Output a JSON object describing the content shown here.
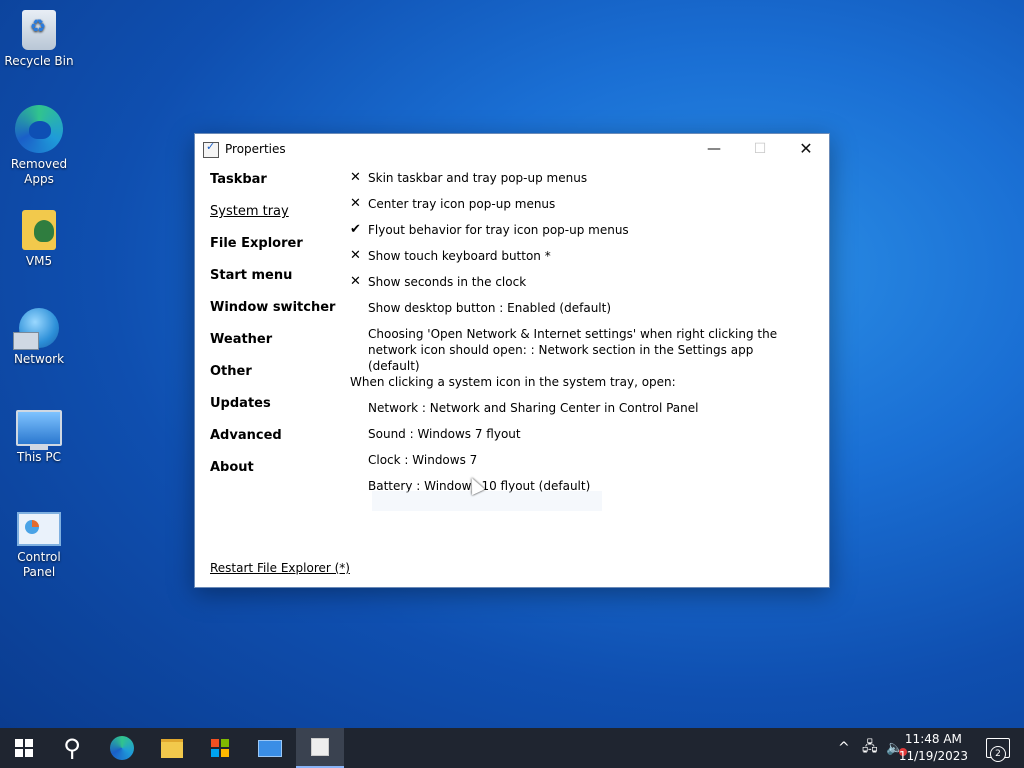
{
  "desktop": {
    "icons": [
      {
        "label": "Recycle Bin"
      },
      {
        "label": "Removed Apps"
      },
      {
        "label": "VM5"
      },
      {
        "label": "Network"
      },
      {
        "label": "This PC"
      },
      {
        "label": "Control Panel"
      }
    ]
  },
  "window": {
    "title": "Properties",
    "minimize": "—",
    "maximize": "☐",
    "close": "✕",
    "nav": [
      {
        "label": "Taskbar"
      },
      {
        "label": "System tray"
      },
      {
        "label": "File Explorer"
      },
      {
        "label": "Start menu"
      },
      {
        "label": "Window switcher"
      },
      {
        "label": "Weather"
      },
      {
        "label": "Other"
      },
      {
        "label": "Updates"
      },
      {
        "label": "Advanced"
      },
      {
        "label": "About"
      }
    ],
    "active_nav": "System tray",
    "options": [
      {
        "mark": "✕",
        "label": "Skin taskbar and tray pop-up menus"
      },
      {
        "mark": "✕",
        "label": "Center tray icon pop-up menus"
      },
      {
        "mark": "✔",
        "label": "Flyout behavior for tray icon pop-up menus"
      },
      {
        "mark": "✕",
        "label": "Show touch keyboard button *"
      },
      {
        "mark": "✕",
        "label": "Show seconds in the clock"
      },
      {
        "mark": "",
        "label": "Show desktop button : Enabled (default)"
      },
      {
        "mark": "",
        "label": "Choosing 'Open Network & Internet settings' when right clicking the network icon should open: : Network section in the Settings app (default)"
      }
    ],
    "tray_heading": "When clicking a system icon in the system tray, open:",
    "tray_options": [
      {
        "label": "Network : Network and Sharing Center in Control Panel"
      },
      {
        "label": "Sound : Windows 7 flyout"
      },
      {
        "label": "Clock : Windows 7"
      },
      {
        "label": "Battery : Windows 10 flyout (default)"
      }
    ],
    "restart_link": "Restart File Explorer (*)"
  },
  "taskbar": {
    "search_icon": "⚲",
    "tray_chevron": "^",
    "tray_network": "🖧",
    "tray_volume": "🔈",
    "time": "11:48 AM",
    "date": "11/19/2023",
    "notification_count": "2"
  }
}
